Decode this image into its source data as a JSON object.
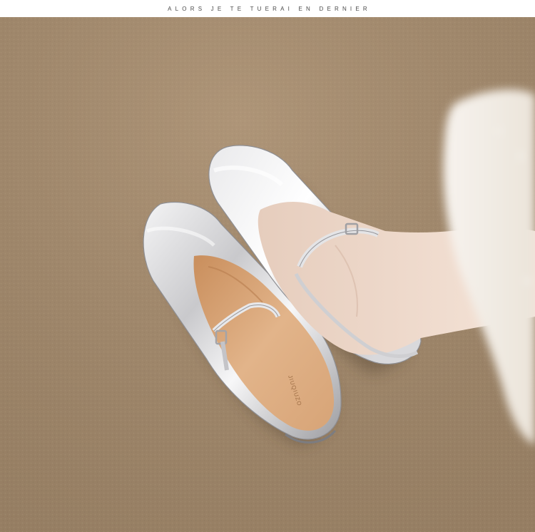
{
  "header": {
    "tagline": "ALORS JE TE TUERAI EN DERNIER"
  },
  "product": {
    "insole_brand": "JIUQIUZO"
  },
  "colors": {
    "carpet": "#a0876a",
    "silver": "#d7d7d9",
    "insole": "#d9a677",
    "skin": "#efd9c9",
    "fabric": "#f3eee7"
  }
}
